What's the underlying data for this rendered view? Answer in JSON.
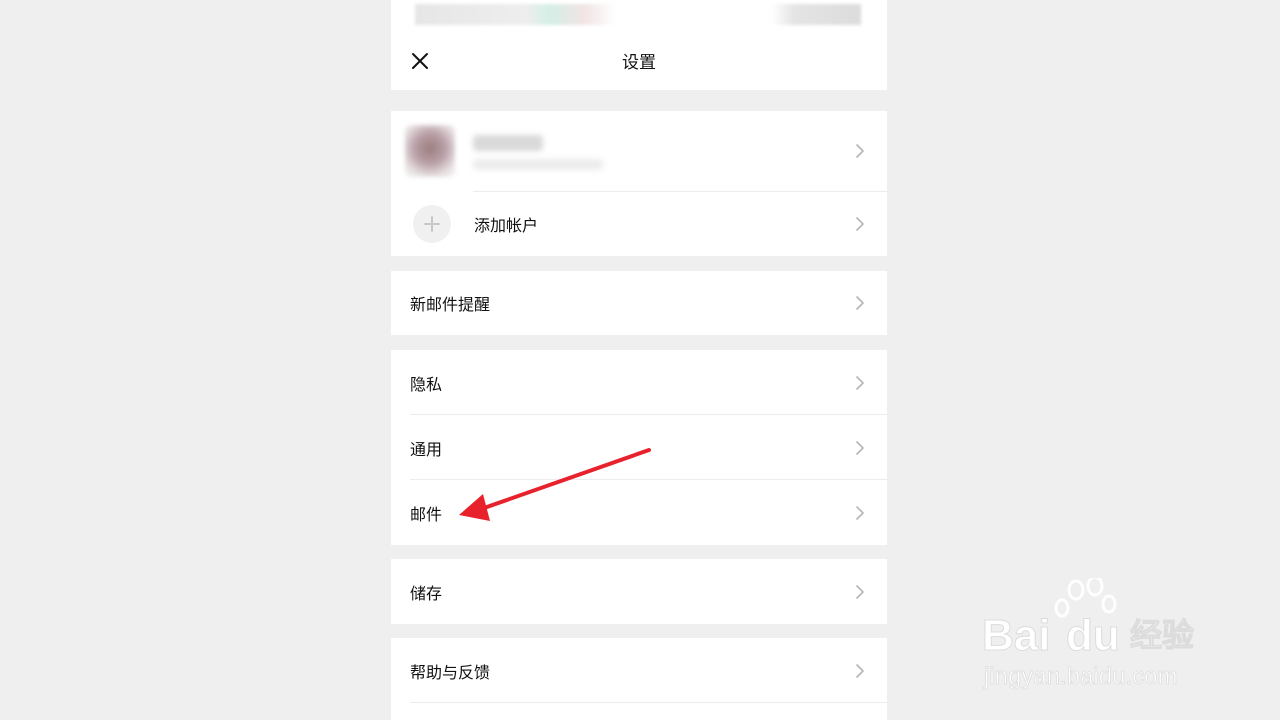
{
  "header": {
    "title": "设置"
  },
  "account_group": {
    "add_account_label": "添加帐户"
  },
  "items": {
    "new_mail_alert": "新邮件提醒",
    "privacy": "隐私",
    "general": "通用",
    "mail": "邮件",
    "storage": "储存",
    "help_feedback": "帮助与反馈"
  },
  "icons": {
    "close": "close-icon",
    "chevron": "chevron-right-icon",
    "plus": "plus-icon"
  },
  "colors": {
    "annotation_arrow": "#e8222d",
    "background": "#efefef"
  },
  "watermark": {
    "brand": "Bai du 经验",
    "url": "jingyan.baidu.com"
  }
}
